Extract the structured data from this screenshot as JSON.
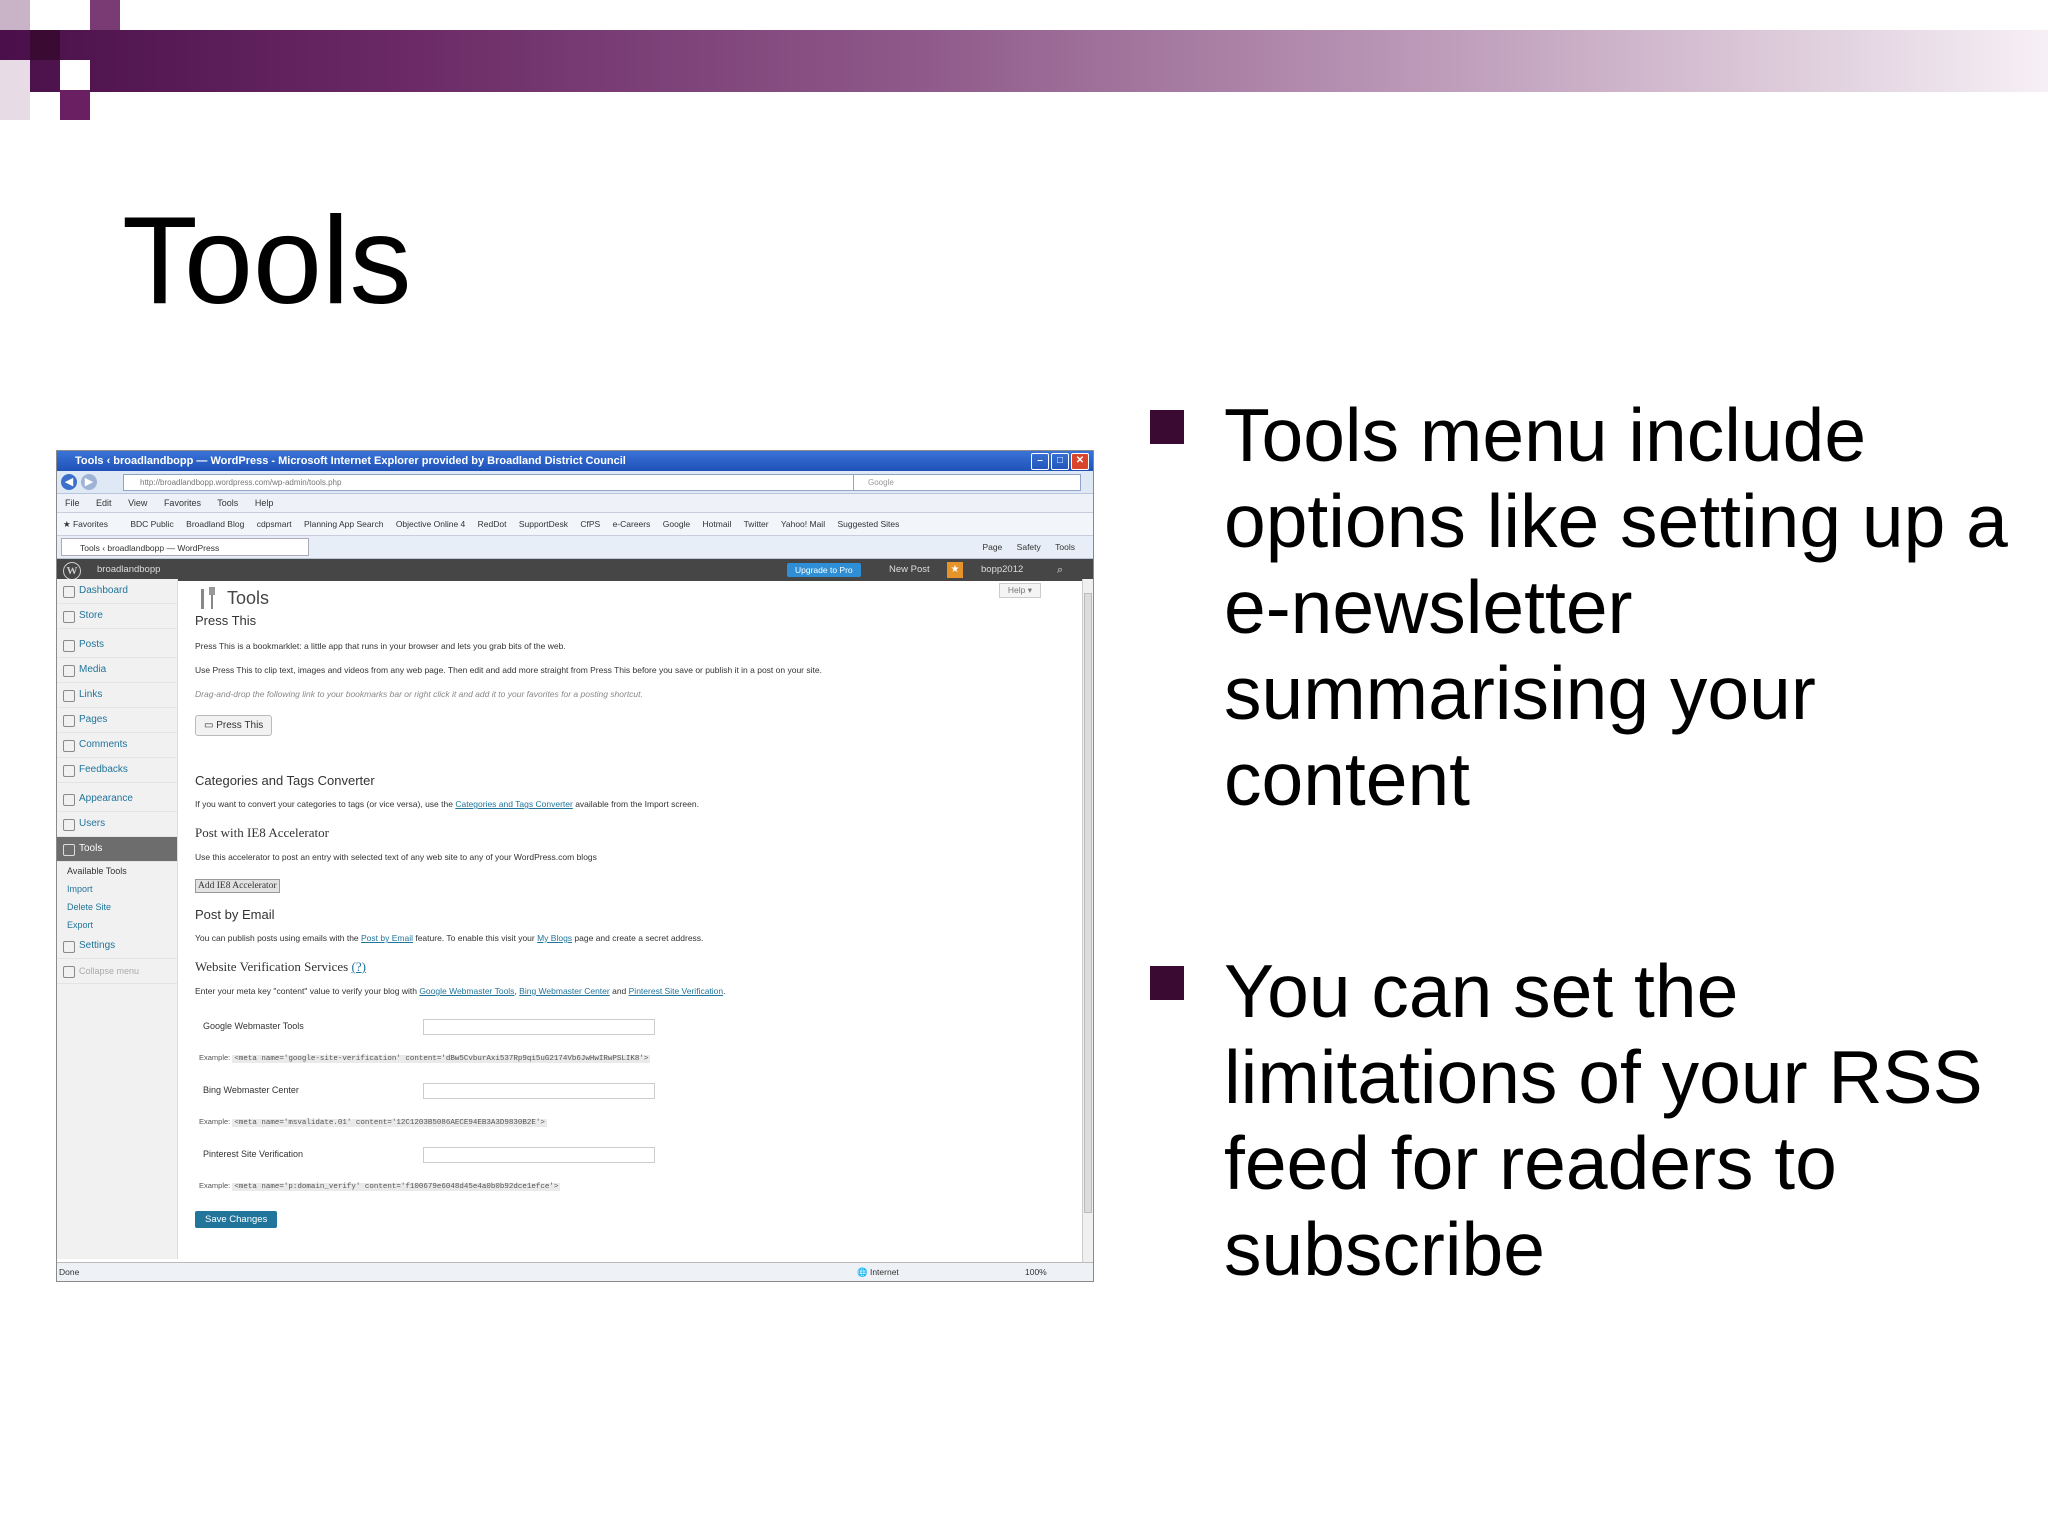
{
  "slide": {
    "title": "Tools",
    "bullets": [
      "Tools menu include options like setting up a e-newsletter summarising your content",
      "You can set the limitations of your RSS feed for readers to subscribe"
    ],
    "colors": {
      "accent": "#4a0f4a",
      "bullet": "#3a0a33"
    }
  },
  "browser": {
    "window_title": "Tools ‹ broadlandbopp — WordPress - Microsoft Internet Explorer provided by Broadland District Council",
    "url": "http://broadlandbopp.wordpress.com/wp-admin/tools.php",
    "search_placeholder": "Google",
    "menu": [
      "File",
      "Edit",
      "View",
      "Favorites",
      "Tools",
      "Help"
    ],
    "favorites_label": "Favorites",
    "favorites": [
      "BDC Public",
      "Broadland Blog",
      "cdpsmart",
      "Planning App Search",
      "Objective Online 4",
      "RedDot",
      "SupportDesk",
      "CfPS",
      "e-Careers",
      "Google",
      "Hotmail",
      "Twitter",
      "Yahoo! Mail",
      "Suggested Sites"
    ],
    "tab_title": "Tools ‹ broadlandbopp — WordPress",
    "command_bar": [
      "Page",
      "Safety",
      "Tools"
    ],
    "status_left": "Done",
    "status_zone": "Internet",
    "status_zoom": "100%"
  },
  "wp": {
    "site_name": "broadlandbopp",
    "upgrade_label": "Upgrade to Pro",
    "new_post_label": "New Post",
    "user_label": "bopp2012",
    "menu": {
      "dashboard": "Dashboard",
      "store": "Store",
      "posts": "Posts",
      "media": "Media",
      "links": "Links",
      "pages": "Pages",
      "comments": "Comments",
      "feedbacks": "Feedbacks",
      "appearance": "Appearance",
      "users": "Users",
      "tools": "Tools",
      "sub": [
        "Available Tools",
        "Import",
        "Delete Site",
        "Export"
      ],
      "settings": "Settings",
      "collapse": "Collapse menu"
    },
    "page_title": "Tools",
    "help_label": "Help ▾",
    "press_this": {
      "heading": "Press This",
      "p1": "Press This is a bookmarklet: a little app that runs in your browser and lets you grab bits of the web.",
      "p2": "Use Press This to clip text, images and videos from any web page. Then edit and add more straight from Press This before you save or publish it in a post on your site.",
      "p3": "Drag-and-drop the following link to your bookmarks bar or right click it and add it to your favorites for a posting shortcut.",
      "button": "Press This"
    },
    "converter": {
      "heading": "Categories and Tags Converter",
      "text_before": "If you want to convert your categories to tags (or vice versa), use the ",
      "link": "Categories and Tags Converter",
      "text_after": " available from the Import screen."
    },
    "ie8": {
      "heading": "Post with IE8 Accelerator",
      "text": "Use this accelerator to post an entry with selected text of any web site to any of your WordPress.com blogs",
      "button": "Add IE8 Accelerator"
    },
    "email": {
      "heading": "Post by Email",
      "t1": "You can publish posts using emails with the ",
      "link1": "Post by Email",
      "t2": " feature. To enable this visit your ",
      "link2": "My Blogs",
      "t3": " page and create a secret address."
    },
    "verification": {
      "heading": "Website Verification Services",
      "help_link": "(?)",
      "t1": "Enter your meta key \"content\" value to verify your blog with ",
      "link1": "Google Webmaster Tools",
      "sep": ", ",
      "link2": "Bing Webmaster Center",
      "and": " and ",
      "link3": "Pinterest Site Verification",
      "end": ".",
      "example_label": "Example:",
      "google_label": "Google Webmaster Tools",
      "google_example": "<meta name='google-site-verification' content='dBw5CvburAxi537Rp9qi5uG2174Vb6JwHwIRwPSLIK8'>",
      "bing_label": "Bing Webmaster Center",
      "bing_example": "<meta name='msvalidate.01' content='12C1203B5086AECE94EB3A3D9830B2E'>",
      "pinterest_label": "Pinterest Site Verification",
      "pinterest_example": "<meta name='p:domain_verify' content='f100679e6048d45e4a0b0b92dce1efce'>"
    },
    "save_button": "Save Changes"
  }
}
